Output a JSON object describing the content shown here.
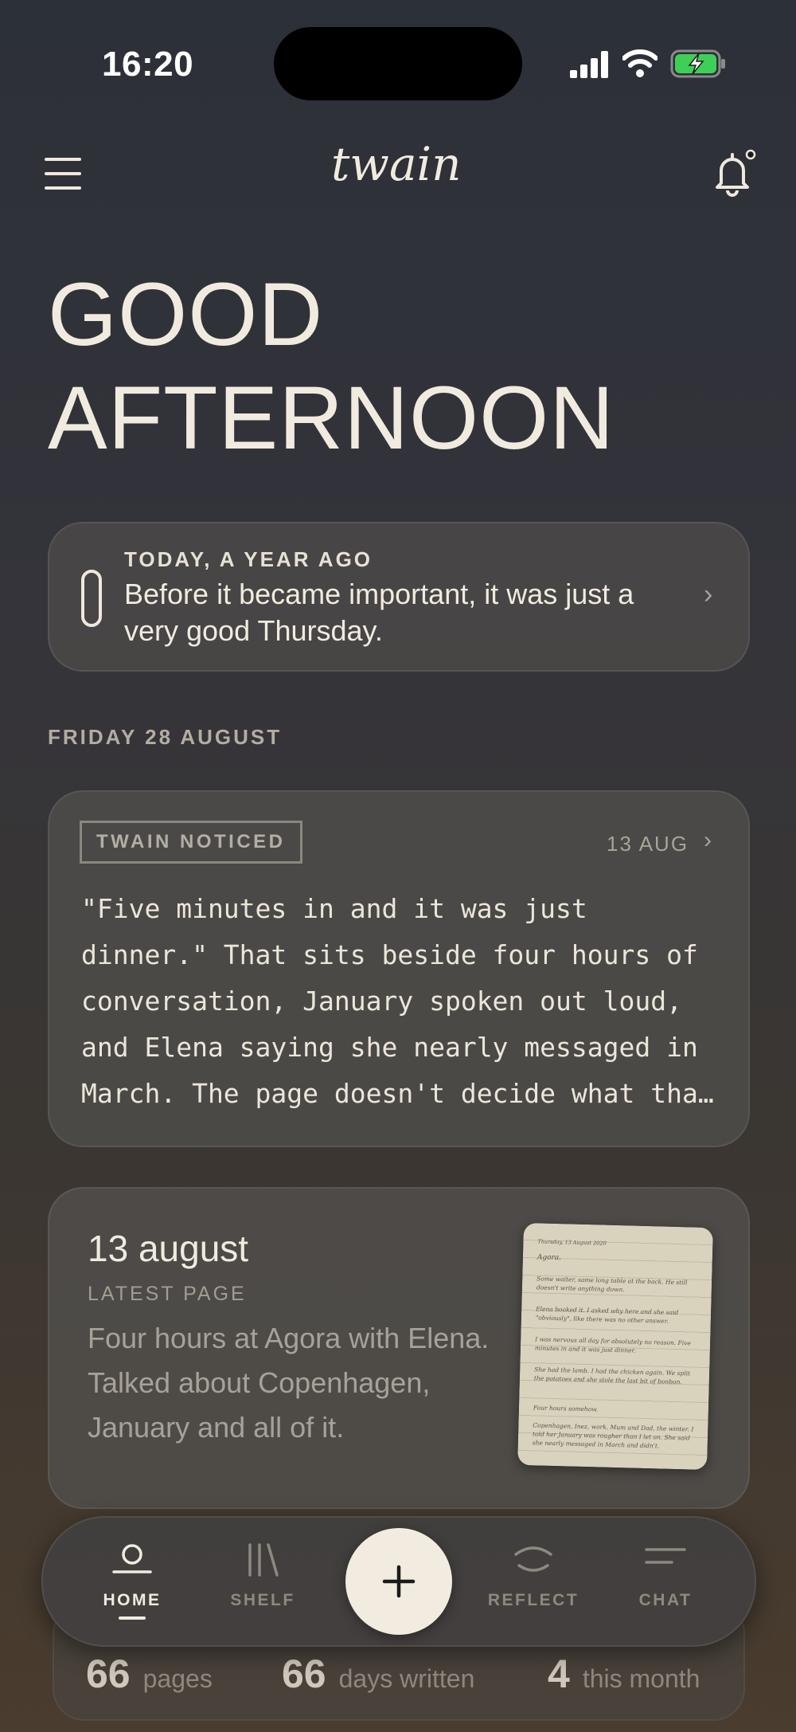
{
  "status_bar": {
    "time": "16:20"
  },
  "header": {
    "logo_text": "twain",
    "menu_icon": "hamburger-icon",
    "bell_icon": "bell-icon"
  },
  "greeting": {
    "line1": "GOOD",
    "line2": "AFTERNOON"
  },
  "memory_card": {
    "eyebrow": "TODAY, A YEAR AGO",
    "text": "Before it became important, it was just a very good Thursday."
  },
  "date_label": "FRIDAY 28 AUGUST",
  "noticed_card": {
    "badge": "TWAIN NOTICED",
    "date": "13 AUG",
    "text": "\"Five minutes in and it was just dinner.\" That sits beside four hours of conversation, January spoken out loud, and Elena saying she nearly messaged in March. The page doesn't decide what that means."
  },
  "latest_card": {
    "title": "13 august",
    "label": "LATEST PAGE",
    "excerpt": "Four hours at Agora with Elena. Talked about Copenhagen, January and all of it.",
    "thumbnail_lines": [
      "Thursday, 13 August 2020",
      "Agora.",
      "Some waiter, same long table at the back. He still doesn't write anything down.",
      "Elena booked it. I asked why here and she said \"obviously\", like there was no other answer.",
      "I was nervous all day for absolutely no reason. Five minutes in and it was just dinner.",
      "She had the lamb. I had the chicken again. We split the potatoes and she stole the last bit of bonbon.",
      "Four hours somehow.",
      "Copenhagen, Inez, work, Mum and Dad, the winter. I told her January was rougher than I let on. She said she nearly messaged in March and didn't."
    ]
  },
  "stats": [
    {
      "value": "66",
      "label": "pages"
    },
    {
      "value": "66",
      "label": "days written"
    },
    {
      "value": "4",
      "label": "this month"
    }
  ],
  "nav": {
    "items": [
      {
        "label": "HOME",
        "icon": "home-icon",
        "active": true
      },
      {
        "label": "SHELF",
        "icon": "shelf-icon",
        "active": false
      },
      {
        "label": "REFLECT",
        "icon": "reflect-icon",
        "active": false
      },
      {
        "label": "CHAT",
        "icon": "chat-icon",
        "active": false
      }
    ],
    "fab_icon": "plus-icon"
  },
  "colors": {
    "accent": "#f2ece0",
    "text": "#efe8dc",
    "muted": "#8e897f"
  }
}
